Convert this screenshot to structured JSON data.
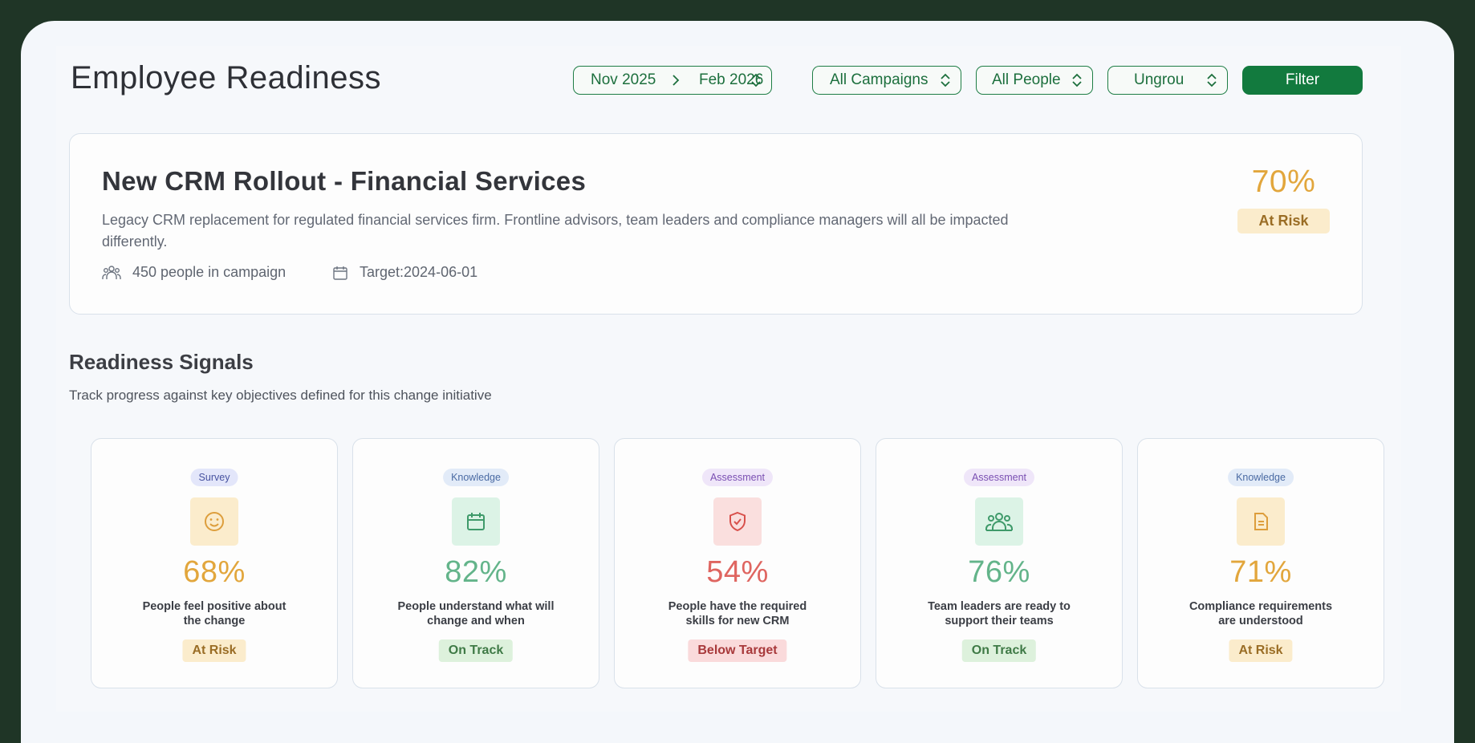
{
  "header": {
    "title": "Employee Readiness",
    "date_from": "Nov 2025",
    "date_to": "Feb 2026",
    "campaign_select": "All Campaigns",
    "people_select": "All People",
    "group_select": "Ungrou",
    "filter_label": "Filter"
  },
  "campaign": {
    "title": "New CRM Rollout - Financial Services",
    "description": "Legacy CRM replacement for regulated financial services firm. Frontline advisors, team leaders and compliance managers will all be impacted differently.",
    "people": "450 people in campaign",
    "target": "Target:2024-06-01",
    "score": "70%",
    "status": "At Risk",
    "score_color": "#e2a63c"
  },
  "signals": {
    "title": "Readiness Signals",
    "subtitle": "Track progress against key objectives defined for this change initiative",
    "cards": [
      {
        "tag": "Survey",
        "icon": "smile-icon",
        "value": "68%",
        "desc": "People feel positive about the change",
        "status": "At Risk",
        "color": "#e2a63c"
      },
      {
        "tag": "Knowledge",
        "icon": "calendar-icon",
        "value": "82%",
        "desc": "People understand what will change and when",
        "status": "On Track",
        "color": "#63b48a"
      },
      {
        "tag": "Assessment",
        "icon": "shield-icon",
        "value": "54%",
        "desc": "People have the required skills for new CRM",
        "status": "Below Target",
        "color": "#df6560"
      },
      {
        "tag": "Assessment",
        "icon": "team-icon",
        "value": "76%",
        "desc": "Team leaders are ready to support their teams",
        "status": "On Track",
        "color": "#63b48a"
      },
      {
        "tag": "Knowledge",
        "icon": "document-icon",
        "value": "71%",
        "desc": "Compliance requirements are understood",
        "status": "At Risk",
        "color": "#e2a63c"
      }
    ]
  }
}
